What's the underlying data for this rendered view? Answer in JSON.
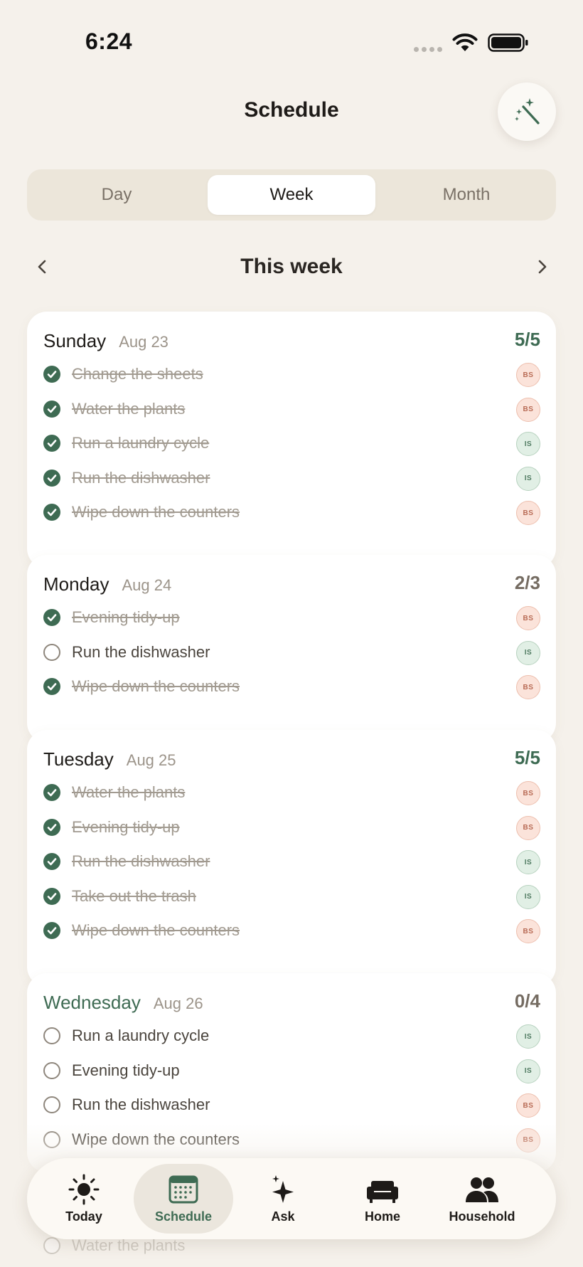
{
  "status_bar": {
    "time": "6:24"
  },
  "header": {
    "title": "Schedule",
    "magic_icon": "magic-wand-icon"
  },
  "view_switcher": {
    "options": [
      "Day",
      "Week",
      "Month"
    ],
    "selected": "Week"
  },
  "week_nav": {
    "title": "This week",
    "prev_icon": "chevron-left-icon",
    "next_icon": "chevron-right-icon"
  },
  "colors": {
    "accent_green": "#3E6B53",
    "assignee_bs": "#FBE3DA",
    "assignee_is": "#E1EFE5",
    "background": "#F5F1EB"
  },
  "days": [
    {
      "name": "Sunday",
      "date": "Aug 23",
      "progress": "5/5",
      "tasks": [
        {
          "label": "Change the sheets",
          "done": true,
          "assignee": "BS"
        },
        {
          "label": "Water the plants",
          "done": true,
          "assignee": "BS"
        },
        {
          "label": "Run a laundry cycle",
          "done": true,
          "assignee": "IS"
        },
        {
          "label": "Run the dishwasher",
          "done": true,
          "assignee": "IS"
        },
        {
          "label": "Wipe down the counters",
          "done": true,
          "assignee": "BS"
        }
      ]
    },
    {
      "name": "Monday",
      "date": "Aug 24",
      "progress": "2/3",
      "tasks": [
        {
          "label": "Evening tidy-up",
          "done": true,
          "assignee": "BS"
        },
        {
          "label": "Run the dishwasher",
          "done": false,
          "assignee": "IS"
        },
        {
          "label": "Wipe down the counters",
          "done": true,
          "assignee": "BS"
        }
      ]
    },
    {
      "name": "Tuesday",
      "date": "Aug 25",
      "progress": "5/5",
      "tasks": [
        {
          "label": "Water the plants",
          "done": true,
          "assignee": "BS"
        },
        {
          "label": "Evening tidy-up",
          "done": true,
          "assignee": "BS"
        },
        {
          "label": "Run the dishwasher",
          "done": true,
          "assignee": "IS"
        },
        {
          "label": "Take out the trash",
          "done": true,
          "assignee": "IS"
        },
        {
          "label": "Wipe down the counters",
          "done": true,
          "assignee": "BS"
        }
      ]
    },
    {
      "name": "Wednesday",
      "date": "Aug 26",
      "progress": "0/4",
      "is_today": true,
      "tasks": [
        {
          "label": "Run a laundry cycle",
          "done": false,
          "assignee": "IS"
        },
        {
          "label": "Evening tidy-up",
          "done": false,
          "assignee": "IS"
        },
        {
          "label": "Run the dishwasher",
          "done": false,
          "assignee": "BS"
        },
        {
          "label": "Wipe down the counters",
          "done": false,
          "assignee": "BS"
        }
      ]
    }
  ],
  "partially_visible_task": {
    "label": "Water the plants"
  },
  "tab_bar": {
    "selected": "Schedule",
    "tabs": [
      {
        "label": "Today",
        "icon": "sun-icon"
      },
      {
        "label": "Schedule",
        "icon": "calendar-icon"
      },
      {
        "label": "Ask",
        "icon": "sparkle-icon"
      },
      {
        "label": "Home",
        "icon": "sofa-icon"
      },
      {
        "label": "Household",
        "icon": "people-icon"
      }
    ]
  }
}
